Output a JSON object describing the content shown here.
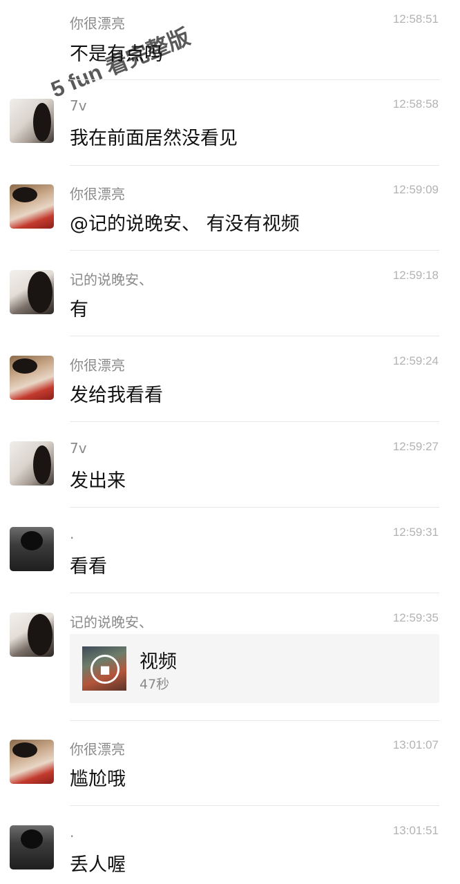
{
  "messages": [
    {
      "name": "你很漂亮",
      "time": "12:58:51",
      "text": "不是有点吗",
      "avatar": "none"
    },
    {
      "name": "7v",
      "time": "12:58:58",
      "text": "我在前面居然没看见",
      "avatar": "light"
    },
    {
      "name": "你很漂亮",
      "time": "12:59:09",
      "text": "@记的说晚安、 有没有视频",
      "avatar": "girl"
    },
    {
      "name": "记的说晚安、",
      "time": "12:59:18",
      "text": "有",
      "avatar": "glasses"
    },
    {
      "name": "你很漂亮",
      "time": "12:59:24",
      "text": "发给我看看",
      "avatar": "girl"
    },
    {
      "name": "7v",
      "time": "12:59:27",
      "text": "发出来",
      "avatar": "light"
    },
    {
      "name": ".",
      "time": "12:59:31",
      "text": "看看",
      "avatar": "dark"
    },
    {
      "name": "记的说晚安、",
      "time": "12:59:35",
      "video": {
        "title": "视频",
        "duration": "47秒"
      },
      "avatar": "glasses"
    },
    {
      "name": "你很漂亮",
      "time": "13:01:07",
      "text": "尴尬哦",
      "avatar": "girl"
    },
    {
      "name": ".",
      "time": "13:01:51",
      "text": "丢人喔",
      "avatar": "dark"
    }
  ],
  "watermark": "5 fun 看完整版",
  "icons": {
    "video": "video-camera-icon"
  }
}
